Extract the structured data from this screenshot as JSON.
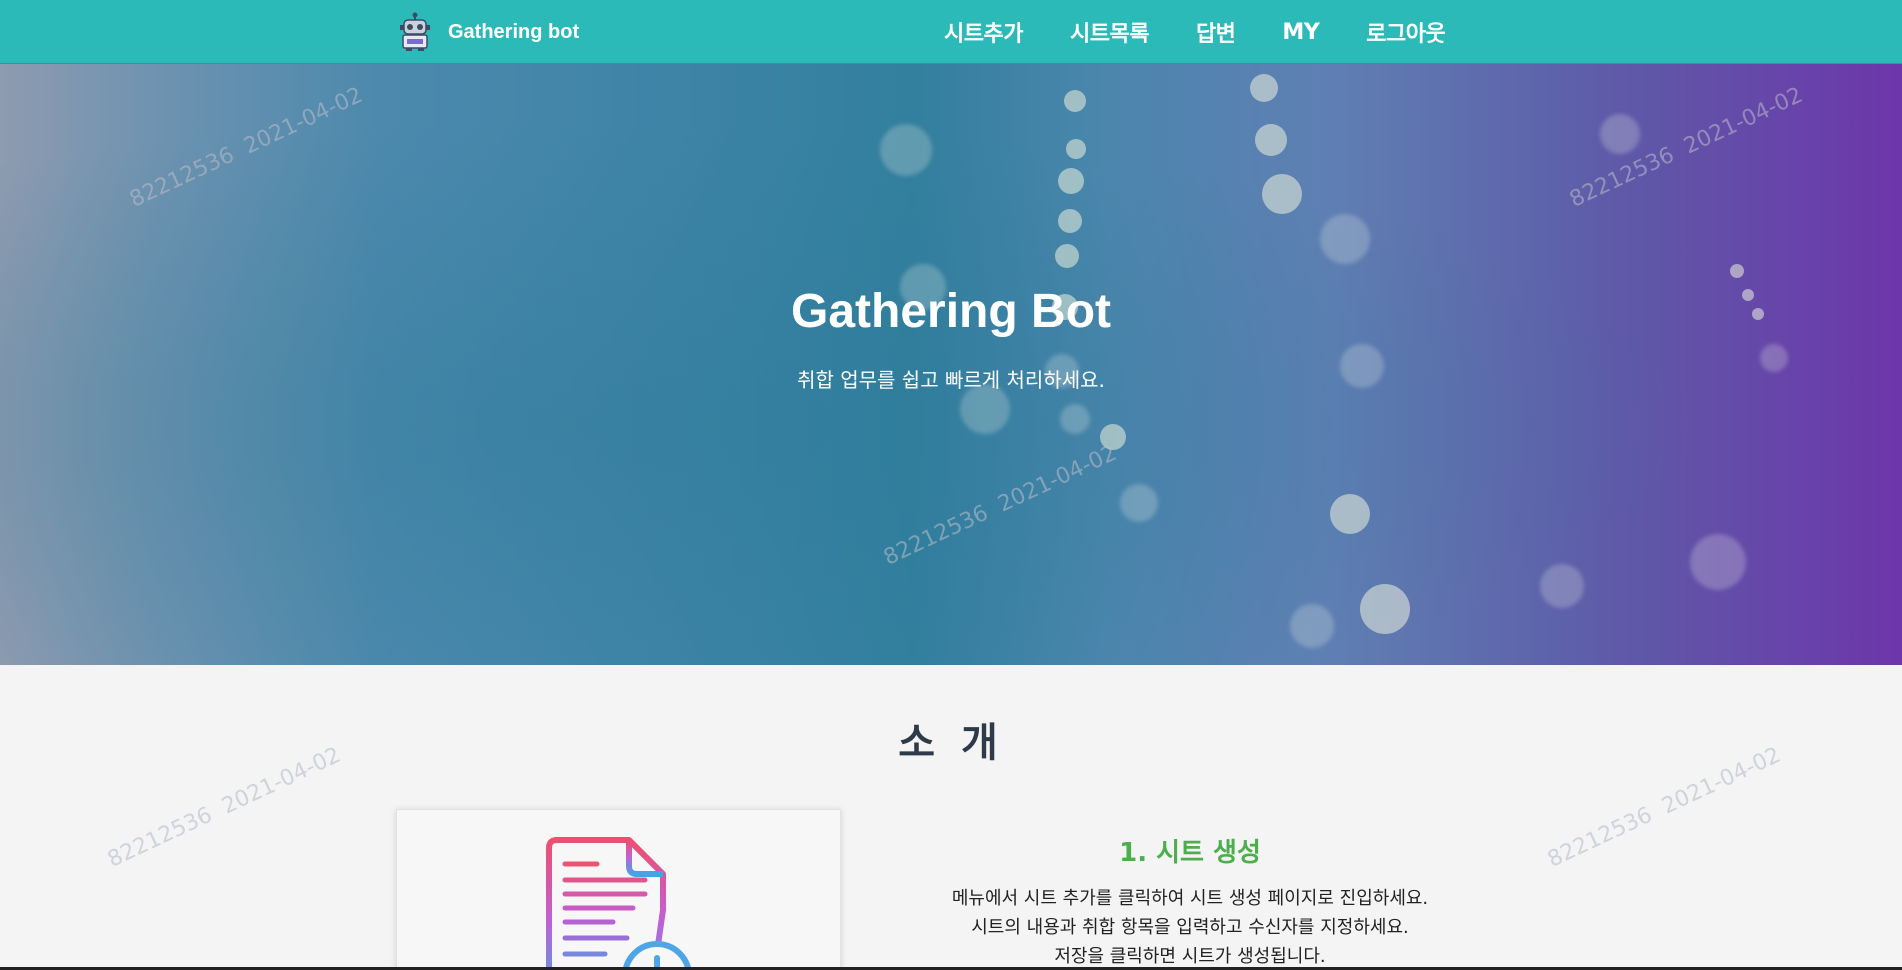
{
  "navbar": {
    "brand": "Gathering bot",
    "items": [
      {
        "label": "시트추가"
      },
      {
        "label": "시트목록"
      },
      {
        "label": "답변"
      },
      {
        "label": "MY"
      },
      {
        "label": "로그아웃"
      }
    ],
    "color": "#2cbab9"
  },
  "hero": {
    "title": "Gathering Bot",
    "subtitle": "취합 업무를 쉽고 빠르게 처리하세요."
  },
  "intro": {
    "heading": "소 개",
    "step1": {
      "title": "1. 시트 생성",
      "lines": [
        "메뉴에서 시트 추가를 클릭하여 시트 생성 페이지로 진입하세요.",
        "시트의 내용과 취합 항목을 입력하고 수신자를 지정하세요.",
        "저장을 클릭하면 시트가 생성됩니다."
      ],
      "icon": "add-document-icon",
      "title_color": "#4cae4c"
    }
  },
  "watermark": {
    "id": "82212536",
    "date": "2021-04-02"
  }
}
